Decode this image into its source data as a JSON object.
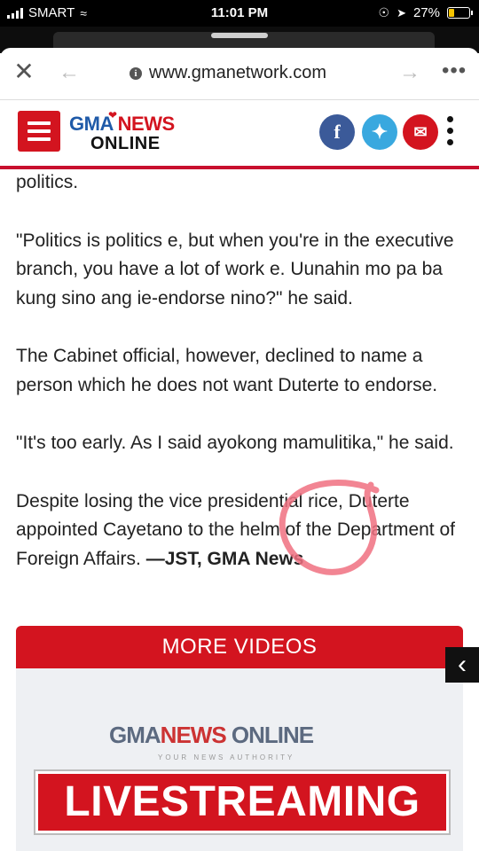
{
  "status_bar": {
    "carrier": "SMART",
    "time": "11:01 PM",
    "battery": "27%"
  },
  "browser": {
    "url": "www.gmanetwork.com",
    "ghost_url": "cayetano-open-to-support"
  },
  "site_header": {
    "logo_line1_a": "GMA",
    "logo_line1_b": "NEWS",
    "logo_line2": "ONLINE"
  },
  "article": {
    "paragraphs": [
      "politics.",
      "\"Politics is politics e, but when you're in the executive branch, you have a lot of work e. Uunahin mo pa ba kung sino ang ie-endorse nino?\" he said.",
      "The Cabinet official, however, declined to name a person which he does not want Duterte to endorse.",
      "\"It's too early. As I said ayokong mamulitika,\" he said.",
      "Despite losing the vice presidential rice, Duterte appointed Cayetano to the helm of the Department of Foreign Affairs."
    ],
    "byline": "—JST, GMA News"
  },
  "videos": {
    "header": "MORE VIDEOS",
    "thumb_logo_a": "GMA",
    "thumb_logo_b": "NEWS",
    "thumb_logo_c": "ONLINE",
    "thumb_tagline": "YOUR NEWS AUTHORITY",
    "thumb_banner": "LIVESTREAMING"
  },
  "colors": {
    "brand_red": "#d3141f",
    "facebook": "#3b5a99",
    "twitter": "#39a8df",
    "annotation": "#f07080"
  }
}
